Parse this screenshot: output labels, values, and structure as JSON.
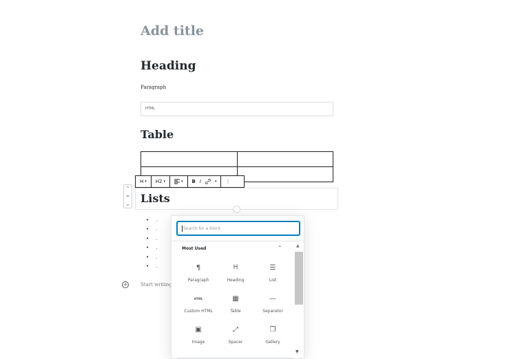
{
  "editor": {
    "title_placeholder": "Add title",
    "heading": "Heading",
    "paragraph": "Paragraph",
    "html_block": "HTML",
    "table_heading": "Table",
    "lists_heading": "Lists",
    "list_items": [
      ".",
      ".",
      ".",
      ".",
      ".",
      "."
    ],
    "start_writing": "Start writing",
    "bullet": "•"
  },
  "toolbar": {
    "heading_btn": "H",
    "level_btn": "H2",
    "bold": "B",
    "italic": "I",
    "more": "⋮",
    "align_icon": "align-icon",
    "link_icon": "link-icon"
  },
  "inserter": {
    "search_placeholder": "Search for a block",
    "panel_title": "Most Used",
    "blocks": [
      {
        "label": "Paragraph",
        "icon": "¶"
      },
      {
        "label": "Heading",
        "icon": "H"
      },
      {
        "label": "List",
        "icon": "☰"
      },
      {
        "label": "Custom HTML",
        "icon": "HTML"
      },
      {
        "label": "Table",
        "icon": "▦"
      },
      {
        "label": "Separator",
        "icon": "—"
      },
      {
        "label": "Image",
        "icon": "▣"
      },
      {
        "label": "Spacer",
        "icon": "⤢"
      },
      {
        "label": "Gallery",
        "icon": "❐"
      }
    ]
  },
  "colors": {
    "accent": "#007cba",
    "title_placeholder": "#8a939c"
  }
}
